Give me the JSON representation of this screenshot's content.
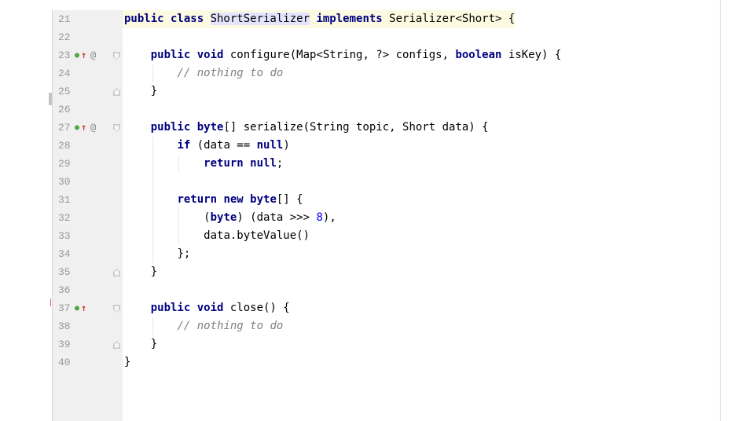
{
  "editor": {
    "lines": [
      {
        "num": "21",
        "tokens": [
          {
            "t": "kw",
            "v": "public class "
          },
          {
            "t": "hl",
            "v": "ShortSerializer"
          },
          {
            "t": "",
            "v": " "
          },
          {
            "t": "kw",
            "v": "implements"
          },
          {
            "t": "",
            "v": " Serializer<Short> {"
          }
        ],
        "indent": 0,
        "current": true
      },
      {
        "num": "22",
        "tokens": [],
        "indent": 0
      },
      {
        "num": "23",
        "tokens": [
          {
            "t": "kw",
            "v": "public void"
          },
          {
            "t": "",
            "v": " configure(Map<String, ?> configs, "
          },
          {
            "t": "kw",
            "v": "boolean"
          },
          {
            "t": "",
            "v": " isKey) {"
          }
        ],
        "indent": 1,
        "gutter": [
          "impl",
          "at"
        ],
        "fold": "open"
      },
      {
        "num": "24",
        "tokens": [
          {
            "t": "cmt",
            "v": "// nothing to do"
          }
        ],
        "indent": 2
      },
      {
        "num": "25",
        "tokens": [
          {
            "t": "",
            "v": "}"
          }
        ],
        "indent": 1,
        "fold": "close"
      },
      {
        "num": "26",
        "tokens": [],
        "indent": 0
      },
      {
        "num": "27",
        "tokens": [
          {
            "t": "kw",
            "v": "public byte"
          },
          {
            "t": "",
            "v": "[] serialize(String topic, Short data) {"
          }
        ],
        "indent": 1,
        "gutter": [
          "impl",
          "at"
        ],
        "fold": "open"
      },
      {
        "num": "28",
        "tokens": [
          {
            "t": "kw",
            "v": "if"
          },
          {
            "t": "",
            "v": " (data == "
          },
          {
            "t": "kw",
            "v": "null"
          },
          {
            "t": "",
            "v": ")"
          }
        ],
        "indent": 2
      },
      {
        "num": "29",
        "tokens": [
          {
            "t": "kw",
            "v": "return null"
          },
          {
            "t": "",
            "v": ";"
          }
        ],
        "indent": 3
      },
      {
        "num": "30",
        "tokens": [],
        "indent": 0
      },
      {
        "num": "31",
        "tokens": [
          {
            "t": "kw",
            "v": "return new byte"
          },
          {
            "t": "",
            "v": "[] {"
          }
        ],
        "indent": 2
      },
      {
        "num": "32",
        "tokens": [
          {
            "t": "",
            "v": "("
          },
          {
            "t": "kw",
            "v": "byte"
          },
          {
            "t": "",
            "v": ") (data >>> "
          },
          {
            "t": "num",
            "v": "8"
          },
          {
            "t": "",
            "v": "),"
          }
        ],
        "indent": 3
      },
      {
        "num": "33",
        "tokens": [
          {
            "t": "",
            "v": "data.byteValue()"
          }
        ],
        "indent": 3
      },
      {
        "num": "34",
        "tokens": [
          {
            "t": "",
            "v": "};"
          }
        ],
        "indent": 2
      },
      {
        "num": "35",
        "tokens": [
          {
            "t": "",
            "v": "}"
          }
        ],
        "indent": 1,
        "fold": "close"
      },
      {
        "num": "36",
        "tokens": [],
        "indent": 0
      },
      {
        "num": "37",
        "tokens": [
          {
            "t": "kw",
            "v": "public void"
          },
          {
            "t": "",
            "v": " close() {"
          }
        ],
        "indent": 1,
        "gutter": [
          "impl"
        ],
        "fold": "open"
      },
      {
        "num": "38",
        "tokens": [
          {
            "t": "cmt",
            "v": "// nothing to do"
          }
        ],
        "indent": 2
      },
      {
        "num": "39",
        "tokens": [
          {
            "t": "",
            "v": "}"
          }
        ],
        "indent": 1,
        "fold": "close"
      },
      {
        "num": "40",
        "tokens": [
          {
            "t": "",
            "v": "}"
          }
        ],
        "indent": 0
      }
    ]
  },
  "icons": {
    "implements_marker": "implements-method-icon",
    "override_marker": "annotation-at-icon",
    "fold_open": "fold-start-icon",
    "fold_close": "fold-end-icon"
  },
  "colors": {
    "keyword": "#000080",
    "number": "#0000ff",
    "comment": "#808080",
    "line_number": "#999999",
    "gutter_bg": "#f0f0f0",
    "current_line": "#fcfae0"
  }
}
